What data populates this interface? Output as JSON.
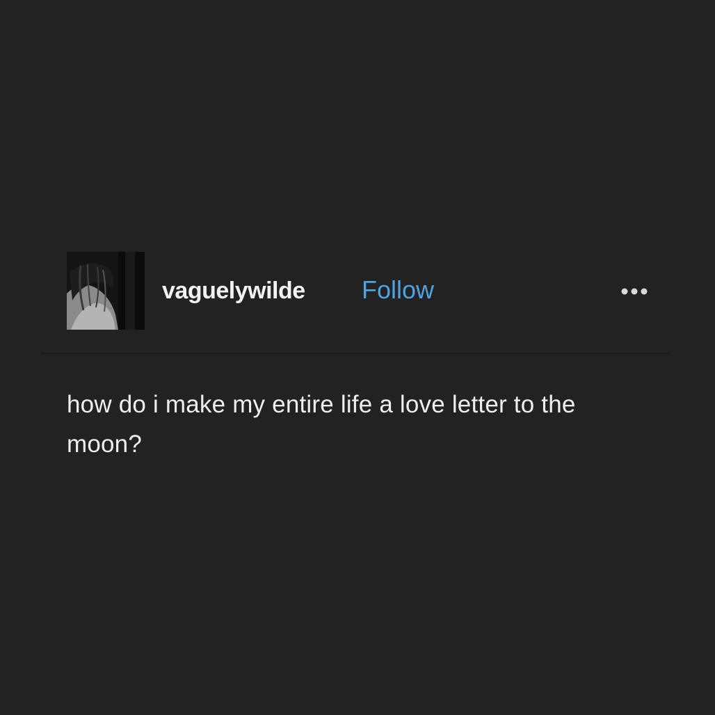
{
  "post": {
    "username": "vaguelywilde",
    "follow_label": "Follow",
    "more_icon": "more-dots-icon",
    "body": "how do i make my entire life a love letter to the moon?"
  },
  "colors": {
    "background": "#222223",
    "accent": "#4fa3de",
    "text": "#efefef"
  }
}
